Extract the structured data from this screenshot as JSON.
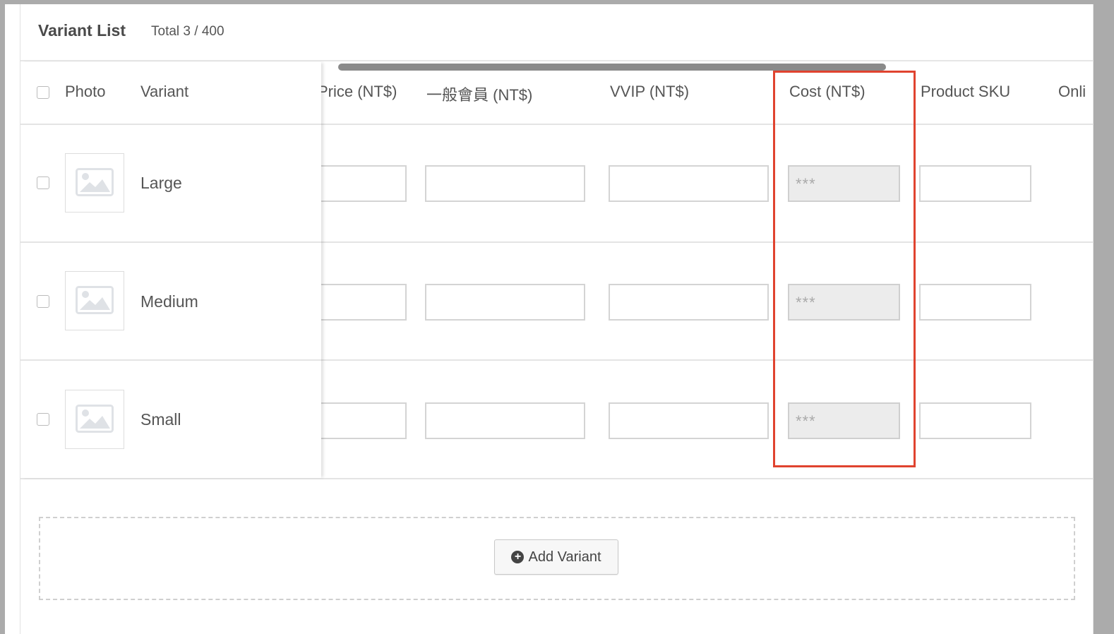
{
  "card": {
    "title": "Variant List",
    "count": "Total 3 / 400"
  },
  "columns": {
    "photo": "Photo",
    "variant": "Variant",
    "price": "Price (NT$)",
    "member": "一般會員 (NT$)",
    "vvip": "VVIP (NT$)",
    "cost": "Cost (NT$)",
    "sku": "Product SKU",
    "online": "Onli"
  },
  "rows": [
    {
      "name": "Large",
      "cost_placeholder": "***"
    },
    {
      "name": "Medium",
      "cost_placeholder": "***"
    },
    {
      "name": "Small",
      "cost_placeholder": "***"
    }
  ],
  "add_button": {
    "label": "Add Variant",
    "icon": "plus-circle-icon"
  },
  "colors": {
    "highlight": "#e0432f",
    "disabled_field": "#ececec"
  }
}
